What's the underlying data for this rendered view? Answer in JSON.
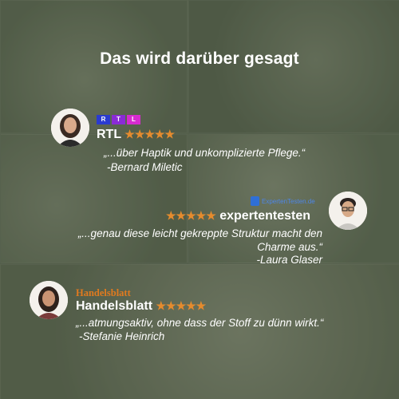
{
  "title": "Das wird darüber gesagt",
  "reviews": [
    {
      "logo": "RTL",
      "source": "RTL",
      "stars": "★★★★★",
      "quote": "„...über Haptik und unkomplizierte Pflege.“",
      "author": "-Bernard Miletic"
    },
    {
      "logo": "ExpertenTesten.de",
      "source": "expertentesten",
      "stars": "★★★★★",
      "quote_line1": "„...genau diese leicht gekreppte Struktur macht den",
      "quote_line2": "Charme aus.“",
      "author": "-Laura Glaser"
    },
    {
      "logo": "Handelsblatt",
      "source": "Handelsblatt",
      "stars": "★★★★★",
      "quote": "„...atmungsaktiv, ohne dass der Stoff zu dünn wirkt.“",
      "author": "-Stefanie Heinrich"
    }
  ],
  "colors": {
    "star": "#e58b2e",
    "text": "#ffffff",
    "background": "#5f6a56"
  }
}
